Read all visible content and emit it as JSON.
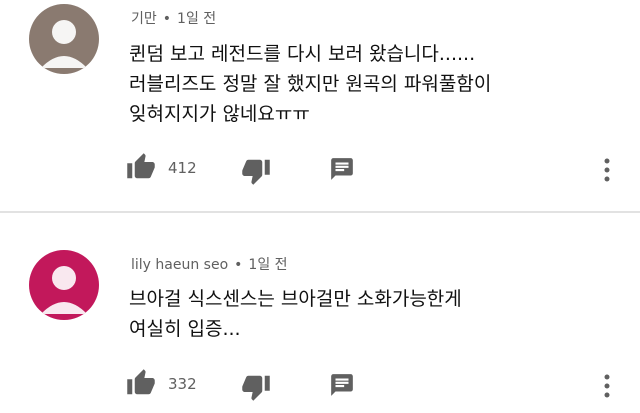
{
  "comments": [
    {
      "author": "기만",
      "time": "1일 전",
      "lines": [
        "퀸덤 보고 레전드를 다시 보러 왔습니다......",
        "러블리즈도 정말 잘 했지만 원곡의 파워풀함이",
        "잊혀지지가 않네요ㅠㅠ"
      ],
      "likes": "412",
      "avatar_bg": "#8a7a70"
    },
    {
      "author": "lily haeun seo",
      "time": "1일 전",
      "lines": [
        "브아걸 식스센스는 브아걸만 소화가능한게",
        "여실히 입증..."
      ],
      "likes": "332",
      "avatar_bg": "#c2185b"
    }
  ],
  "icons": {
    "like": "thumbs-up-icon",
    "dislike": "thumbs-down-icon",
    "reply": "reply-icon",
    "more": "more-vert-icon"
  },
  "separator": "•"
}
